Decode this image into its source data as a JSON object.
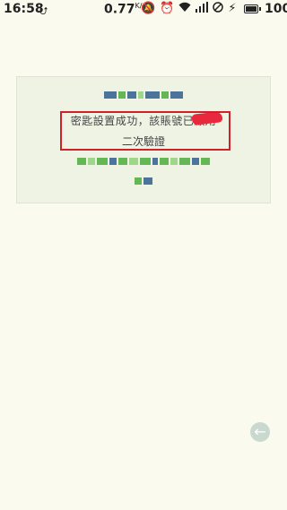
{
  "status_bar": {
    "time": "16:58",
    "network_speed": "0.77",
    "network_speed_unit": "K/s",
    "battery": "100"
  },
  "message": {
    "line1": "密匙設置成功，該賬號已啟用",
    "line2": "二次驗證"
  },
  "icons": {
    "usb": "usb-icon",
    "mute": "mute-icon",
    "alarm": "alarm-icon",
    "wifi": "wifi-icon",
    "signal": "signal-icon",
    "no_sim": "no-sim-icon",
    "charging": "charging-icon",
    "back": "back-arrow-icon"
  },
  "colors": {
    "background": "#fafbee",
    "card": "#eef3e4",
    "highlight_border": "#d0212a",
    "back_button": "#c9d9d0"
  }
}
